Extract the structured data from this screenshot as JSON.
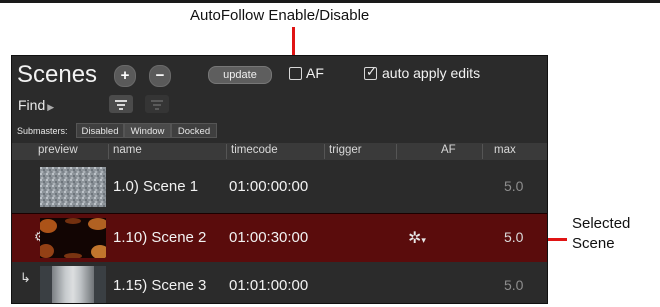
{
  "callouts": {
    "autofollow": "AutoFollow Enable/Disable",
    "selected_line1": "Selected",
    "selected_line2": "Scene"
  },
  "panel": {
    "title": "Scenes",
    "add_icon": "plus-circle-icon",
    "remove_icon": "minus-circle-icon",
    "update_label": "update",
    "af_label": "AF",
    "af_checked": false,
    "auto_apply_label": "auto apply edits",
    "auto_apply_checked": true,
    "find_label": "Find",
    "submasters_label": "Submasters:",
    "submaster_options": [
      "Disabled",
      "Window",
      "Docked"
    ]
  },
  "columns": {
    "preview": "preview",
    "name": "name",
    "timecode": "timecode",
    "trigger": "trigger",
    "af": "AF",
    "max": "max"
  },
  "rows": [
    {
      "name": "1.0) Scene 1",
      "timecode": "01:00:00:00",
      "max": "5.0",
      "selected": false
    },
    {
      "name": "1.10) Scene 2",
      "timecode": "01:00:30:00",
      "max": "5.0",
      "selected": true,
      "af_icon": "gear-icon"
    },
    {
      "name": "1.15) Scene 3",
      "timecode": "01:01:00:00",
      "max": "5.0",
      "selected": false,
      "child_indicator": "↳"
    }
  ],
  "colors": {
    "panel_bg": "#2b2b2b",
    "selected_row": "#5a0c0c",
    "callout_red": "#e01414"
  }
}
